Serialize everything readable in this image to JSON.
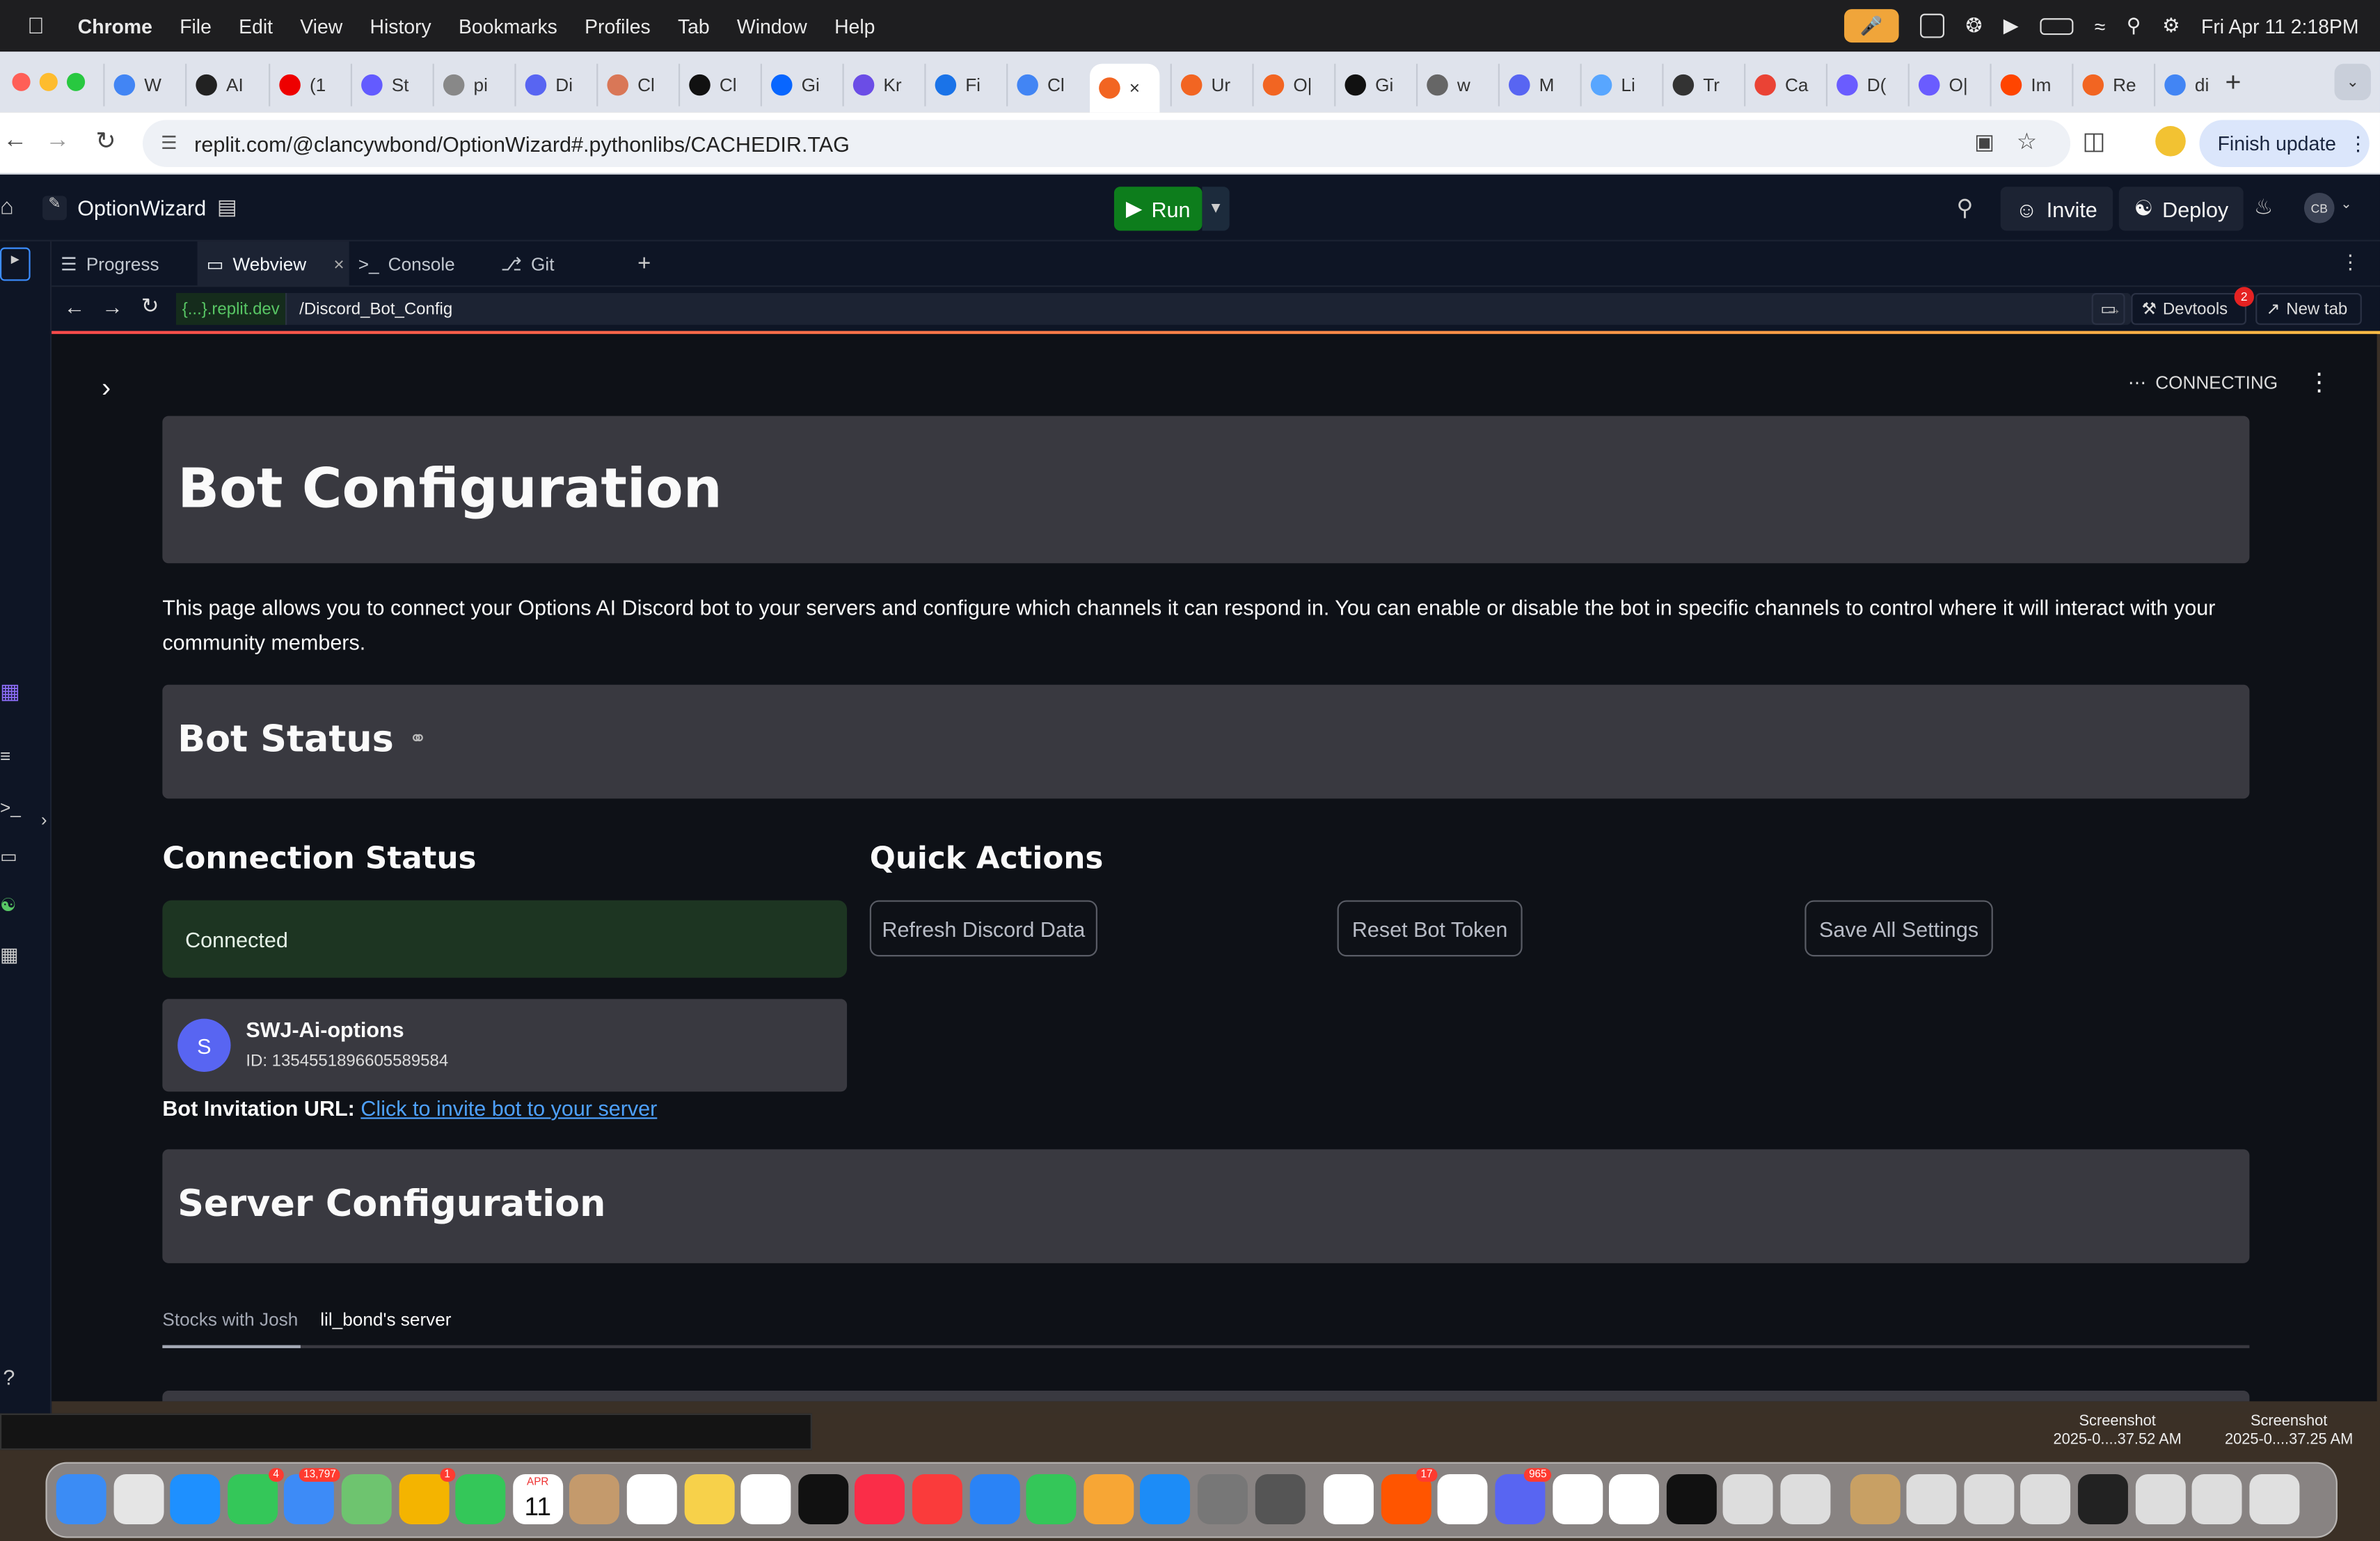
{
  "menubar": {
    "app": "Chrome",
    "items": [
      "File",
      "Edit",
      "View",
      "History",
      "Bookmarks",
      "Profiles",
      "Tab",
      "Window",
      "Help"
    ],
    "datetime": "Fri Apr 11  2:18PM"
  },
  "chrome": {
    "tabs": [
      "W",
      "AI",
      "(1",
      "St",
      "pi",
      "Di",
      "Cl",
      "Cl",
      "Gi",
      "Kr",
      "Fi",
      "Cl",
      "",
      "Ur",
      "O|",
      "Gi",
      "w",
      "M",
      "Li",
      "Tr",
      "Ca",
      "D(",
      "O|",
      "Im",
      "Re",
      "di"
    ],
    "url": "replit.com/@clancywbond/OptionWizard#.pythonlibs/CACHEDIR.TAG",
    "finish_update": "Finish update"
  },
  "replit": {
    "repl_name": "OptionWizard",
    "run": "Run",
    "invite": "Invite",
    "deploy": "Deploy",
    "avatar": "CB",
    "panel_tabs": [
      "Progress",
      "Webview",
      "Console",
      "Git"
    ],
    "webview": {
      "domain": "{...}.replit.dev",
      "path": "/Discord_Bot_Config",
      "devtools": "Devtools",
      "devtools_badge": "2",
      "new_tab": "New tab"
    }
  },
  "app": {
    "status": "CONNECTING",
    "title": "Bot Configuration",
    "description": "This page allows you to connect your Options AI Discord bot to your servers and configure which channels it can respond in. You can enable or disable the bot in specific channels to control where it will interact with your community members.",
    "bot_status_heading": "Bot Status",
    "connection_status_heading": "Connection Status",
    "connected_label": "Connected",
    "bot": {
      "avatar_letter": "S",
      "name": "SWJ-Ai-options",
      "id": "ID: 1354551896605589584"
    },
    "invite_label": "Bot Invitation URL:",
    "invite_link": "Click to invite bot to your server",
    "quick_actions_heading": "Quick Actions",
    "buttons": [
      "Refresh Discord Data",
      "Reset Bot Token",
      "Save All Settings"
    ],
    "server_config_heading": "Server Configuration",
    "server_tabs": [
      "Stocks with Josh",
      "lil_bond's server"
    ]
  },
  "desktop": {
    "screenshots": [
      {
        "title": "Screenshot",
        "subtitle": "2025-0....37.52 AM"
      },
      {
        "title": "Screenshot",
        "subtitle": "2025-0....37.25 AM"
      }
    ]
  },
  "dock": {
    "badges": {
      "messages": "4",
      "mail": "13,797",
      "photos": "1",
      "calendar_month": "APR",
      "calendar_day": "11",
      "brave": "17",
      "discord": "965"
    }
  },
  "colors": {
    "replit_bg": "#0e1525",
    "streamlit_bg": "#0e1117",
    "panel": "#393940",
    "connected_bg": "#1d3522",
    "run_green": "#0d7d1c",
    "link": "#4ea1ff"
  }
}
